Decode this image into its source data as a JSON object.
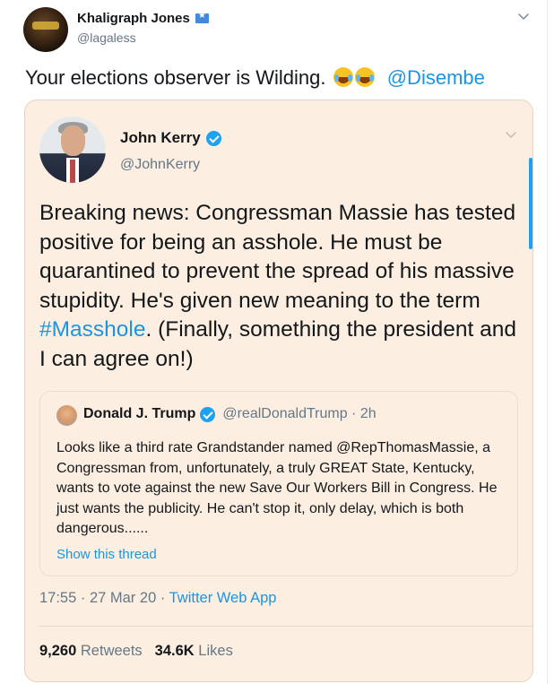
{
  "outer_tweet": {
    "display_name": "Khaligraph Jones",
    "handle": "@lagaless",
    "text": "Your elections observer is Wilding.",
    "mention": "@Disembe"
  },
  "quoted_tweet": {
    "display_name": "John Kerry",
    "handle": "@JohnKerry",
    "text_before": "Breaking news: Congressman Massie has tested positive for being an asshole. He must be quarantined to prevent the spread of his massive stupidity. He's given new meaning to the term ",
    "hashtag": "#Masshole",
    "text_after": ". (Finally, something the president and I can agree on!)",
    "time": "17:55 · 27 Mar 20 · ",
    "source": "Twitter Web App",
    "retweets_count": "9,260",
    "retweets_label": "Retweets",
    "likes_count": "34.6K",
    "likes_label": "Likes"
  },
  "nested_tweet": {
    "display_name": "Donald J. Trump",
    "handle_time": "@realDonaldTrump · 2h",
    "text": "Looks like a third rate Grandstander named @RepThomasMassie, a Congressman from, unfortunately, a truly GREAT State, Kentucky, wants to vote against the new Save Our Workers Bill in Congress. He just wants the publicity. He can't stop it, only delay, which is both dangerous......",
    "show_thread": "Show this thread"
  }
}
